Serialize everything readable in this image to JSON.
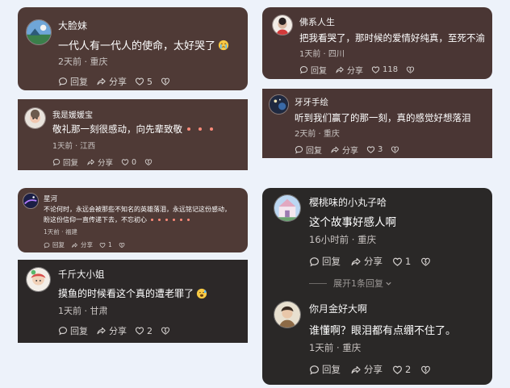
{
  "comments": [
    {
      "name": "大脸妹",
      "text": "一代人有一代人的使命，太好哭了",
      "meta": "2天前 · 重庆",
      "reply": "回复",
      "share": "分享",
      "likes": "5"
    },
    {
      "name": "佛系人生",
      "text": "把我看哭了，那时候的爱情好纯真，至死不渝",
      "meta": "1天前 · 四川",
      "reply": "回复",
      "share": "分享",
      "likes": "118"
    },
    {
      "name": "我是媛媛宝",
      "text": "敬礼那一刻很感动，向先辈致敬",
      "meta": "1天前 · 江西",
      "reply": "回复",
      "share": "分享",
      "likes": "0"
    },
    {
      "name": "牙牙手绘",
      "text": "听到我们赢了的那一刻，真的感觉好想落泪",
      "meta": "2天前 · 重庆",
      "reply": "回复",
      "share": "分享",
      "likes": "3"
    },
    {
      "name": "星河",
      "text_line1": "不论何时，永远会被那些不知名的英雄落泪，永远铭记这份感动，",
      "text_line2": "盼这份信仰一直传递下去，不忘初心",
      "meta": "1天前 · 福建",
      "reply": "回复",
      "share": "分享",
      "likes": "1"
    },
    {
      "name": "千斤大小姐",
      "text": "摸鱼的时候看这个真的遭老罪了",
      "meta": "1天前 · 甘肃",
      "reply": "回复",
      "share": "分享",
      "likes": "2"
    },
    {
      "name": "樱桃味的小丸子哈",
      "text": "这个故事好感人啊",
      "meta": "16小时前 · 重庆",
      "reply": "回复",
      "share": "分享",
      "likes": "1",
      "expand": "展开1条回复"
    },
    {
      "name": "你月金好大啊",
      "text": "谁懂啊？眼泪都有点绷不住了。",
      "meta": "1天前 · 重庆",
      "reply": "回复",
      "share": "分享",
      "likes": "2"
    }
  ],
  "colors": {
    "accent": "#ff8b7a",
    "page_bg": "#edf2fa"
  },
  "icons": [
    "reply-icon",
    "share-icon",
    "heart-icon",
    "dislike-icon",
    "chevron-down-icon"
  ]
}
